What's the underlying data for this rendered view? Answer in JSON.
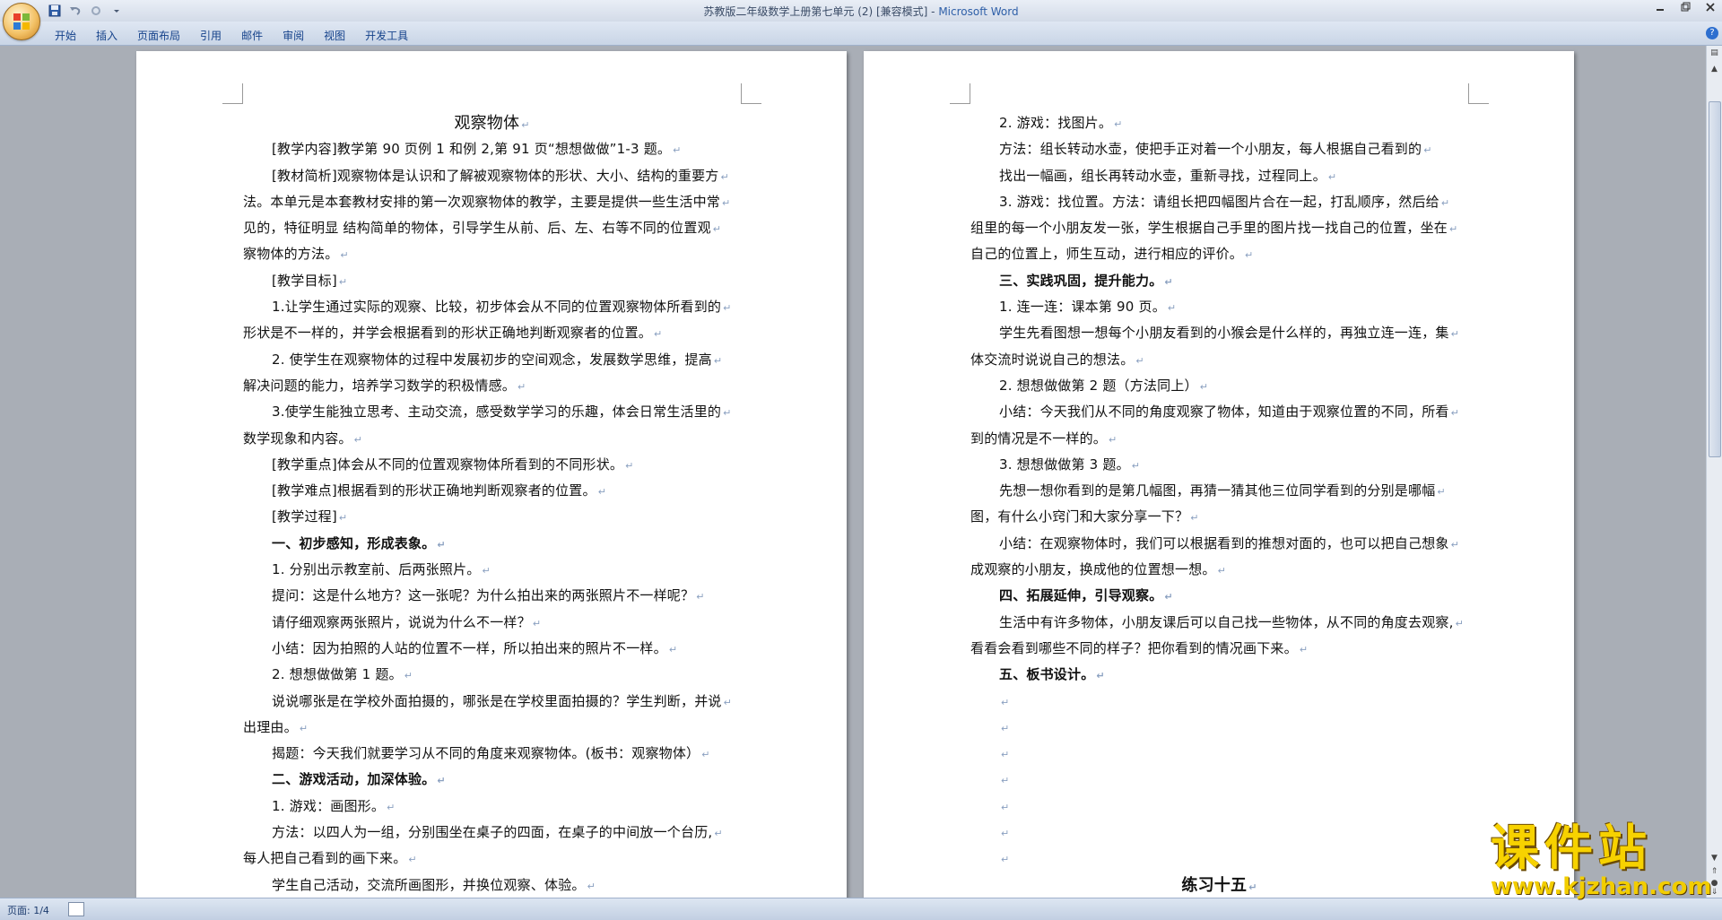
{
  "titlebar": {
    "document_title": "苏教版二年级数学上册第七单元 (2) [兼容模式] - ",
    "app_name": "Microsoft Word"
  },
  "ribbon": {
    "tabs": [
      "开始",
      "插入",
      "页面布局",
      "引用",
      "邮件",
      "审阅",
      "视图",
      "开发工具"
    ]
  },
  "left_page": {
    "lines": [
      {
        "text": "观察物体",
        "style": "title"
      },
      {
        "text": "[教学内容]教学第 90 页例 1 和例 2,第 91 页“想想做做”1-3 题。",
        "style": "indent"
      },
      {
        "text": "[教材简析]观察物体是认识和了解被观察物体的形状、大小、结构的重要方",
        "style": "indent"
      },
      {
        "text": "法。本单元是本套教材安排的第一次观察物体的教学，主要是提供一些生活中常",
        "style": ""
      },
      {
        "text": "见的，特征明显 结构简单的物体，引导学生从前、后、左、右等不同的位置观",
        "style": ""
      },
      {
        "text": "察物体的方法。",
        "style": ""
      },
      {
        "text": "[教学目标]",
        "style": "indent"
      },
      {
        "text": "1.让学生通过实际的观察、比较，初步体会从不同的位置观察物体所看到的",
        "style": "indent"
      },
      {
        "text": "形状是不一样的，并学会根据看到的形状正确地判断观察者的位置。",
        "style": ""
      },
      {
        "text": "2. 使学生在观察物体的过程中发展初步的空间观念，发展数学思维，提高",
        "style": "indent"
      },
      {
        "text": "解决问题的能力，培养学习数学的积极情感。",
        "style": ""
      },
      {
        "text": "3.使学生能独立思考、主动交流，感受数学学习的乐趣，体会日常生活里的",
        "style": "indent"
      },
      {
        "text": "数学现象和内容。",
        "style": ""
      },
      {
        "text": "[教学重点]体会从不同的位置观察物体所看到的不同形状。",
        "style": "indent"
      },
      {
        "text": "[教学难点]根据看到的形状正确地判断观察者的位置。",
        "style": "indent"
      },
      {
        "text": "[教学过程]",
        "style": "indent"
      },
      {
        "text": "一、初步感知，形成表象。",
        "style": "indent bold"
      },
      {
        "text": "1. 分别出示教室前、后两张照片。",
        "style": "indent"
      },
      {
        "text": "提问：这是什么地方？这一张呢？为什么拍出来的两张照片不一样呢？",
        "style": "indent"
      },
      {
        "text": "请仔细观察两张照片，说说为什么不一样？",
        "style": "indent"
      },
      {
        "text": "小结：因为拍照的人站的位置不一样，所以拍出来的照片不一样。",
        "style": "indent"
      },
      {
        "text": "2. 想想做做第 1 题。",
        "style": "indent"
      },
      {
        "text": "说说哪张是在学校外面拍摄的，哪张是在学校里面拍摄的？学生判断，并说",
        "style": "indent"
      },
      {
        "text": "出理由。",
        "style": ""
      },
      {
        "text": "揭题：今天我们就要学习从不同的角度来观察物体。(板书：观察物体）",
        "style": "indent"
      },
      {
        "text": "二、游戏活动，加深体验。",
        "style": "indent bold"
      },
      {
        "text": "1. 游戏：画图形。",
        "style": "indent"
      },
      {
        "text": "方法：以四人为一组，分别围坐在桌子的四面，在桌子的中间放一个台历,",
        "style": "indent"
      },
      {
        "text": "每人把自己看到的画下来。",
        "style": ""
      },
      {
        "text": "学生自己活动，交流所画图形，并换位观察、体验。",
        "style": "indent"
      }
    ]
  },
  "right_page": {
    "lines": [
      {
        "text": "2. 游戏：找图片。",
        "style": "indent"
      },
      {
        "text": "方法：组长转动水壶，使把手正对着一个小朋友，每人根据自己看到的",
        "style": "indent"
      },
      {
        "text": "找出一幅画，组长再转动水壶，重新寻找，过程同上。",
        "style": "indent"
      },
      {
        "text": "3. 游戏：找位置。方法：请组长把四幅图片合在一起，打乱顺序，然后给",
        "style": "indent"
      },
      {
        "text": "组里的每一个小朋友发一张，学生根据自己手里的图片找一找自己的位置，坐在",
        "style": ""
      },
      {
        "text": "自己的位置上，师生互动，进行相应的评价。",
        "style": ""
      },
      {
        "text": "三、实践巩固，提升能力。",
        "style": "indent bold"
      },
      {
        "text": "1. 连一连：课本第 90 页。",
        "style": "indent"
      },
      {
        "text": "学生先看图想一想每个小朋友看到的小猴会是什么样的，再独立连一连，集",
        "style": "indent"
      },
      {
        "text": "体交流时说说自己的想法。",
        "style": ""
      },
      {
        "text": "2. 想想做做第 2 题（方法同上）",
        "style": "indent"
      },
      {
        "text": "小结：今天我们从不同的角度观察了物体，知道由于观察位置的不同，所看",
        "style": "indent"
      },
      {
        "text": "到的情况是不一样的。",
        "style": ""
      },
      {
        "text": "3. 想想做做第 3 题。",
        "style": "indent"
      },
      {
        "text": "先想一想你看到的是第几幅图，再猜一猜其他三位同学看到的分别是哪幅",
        "style": "indent"
      },
      {
        "text": "图，有什么小窍门和大家分享一下？",
        "style": ""
      },
      {
        "text": "小结：在观察物体时，我们可以根据看到的推想对面的，也可以把自己想象",
        "style": "indent"
      },
      {
        "text": "成观察的小朋友，换成他的位置想一想。",
        "style": ""
      },
      {
        "text": "四、拓展延伸，引导观察。",
        "style": "indent bold"
      },
      {
        "text": "生活中有许多物体，小朋友课后可以自己找一些物体，从不同的角度去观察,",
        "style": "indent"
      },
      {
        "text": "看看会看到哪些不同的样子？把你看到的情况画下来。",
        "style": ""
      },
      {
        "text": "五、板书设计。",
        "style": "indent bold"
      },
      {
        "text": "",
        "style": "indent"
      },
      {
        "text": "",
        "style": "indent"
      },
      {
        "text": "",
        "style": "indent"
      },
      {
        "text": "",
        "style": "indent"
      },
      {
        "text": "",
        "style": "indent"
      },
      {
        "text": "",
        "style": "indent"
      },
      {
        "text": "",
        "style": "indent"
      },
      {
        "text": "练习十五",
        "style": "heading"
      }
    ]
  },
  "statusbar": {
    "page_info": "页面: 1/4"
  },
  "watermark": {
    "title": "课件站",
    "url": "www.kjzhan.com"
  }
}
